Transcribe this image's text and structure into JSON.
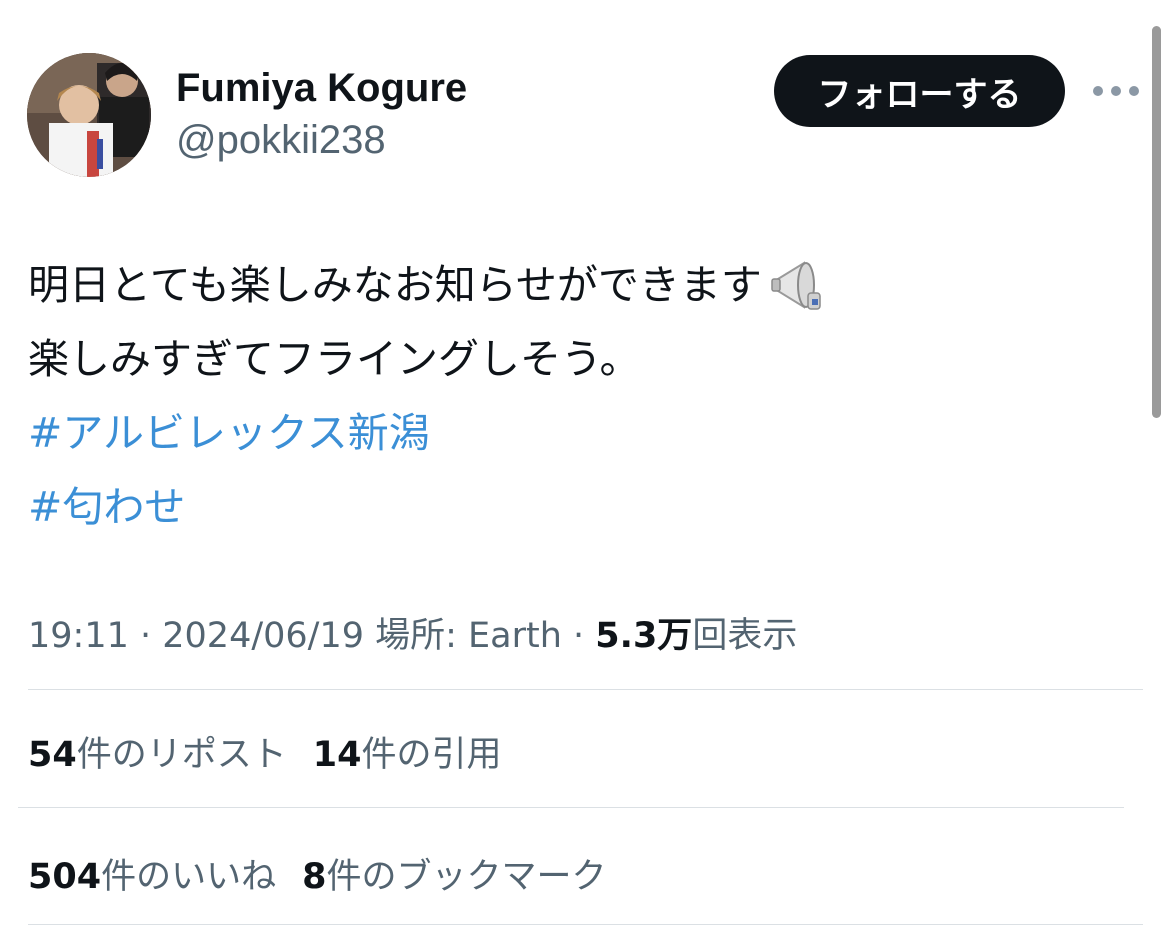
{
  "user": {
    "display_name": "Fumiya Kogure",
    "handle": "@pokkii238",
    "follow_label": "フォローする"
  },
  "tweet": {
    "line1": "明日とても楽しみなお知らせができます",
    "line1_emoji": "megaphone-icon",
    "line2": "楽しみすぎてフライングしそう。",
    "hashtag1": "#アルビレックス新潟",
    "hashtag2": "#匂わせ"
  },
  "meta": {
    "time": "19:11",
    "separator1": " · ",
    "date": "2024/06/19",
    "location": " 場所: Earth",
    "separator2": " · ",
    "views_count": "5.3万",
    "views_label": "回表示"
  },
  "stats": {
    "reposts_count": "54",
    "reposts_label": "件のリポスト",
    "quotes_count": "14",
    "quotes_label": "件の引用",
    "likes_count": "504",
    "likes_label": "件のいいね",
    "bookmarks_count": "8",
    "bookmarks_label": "件のブックマーク"
  },
  "colors": {
    "hashtag": "#3b8fd6",
    "button_bg": "#0f1419",
    "secondary_text": "#536471"
  }
}
